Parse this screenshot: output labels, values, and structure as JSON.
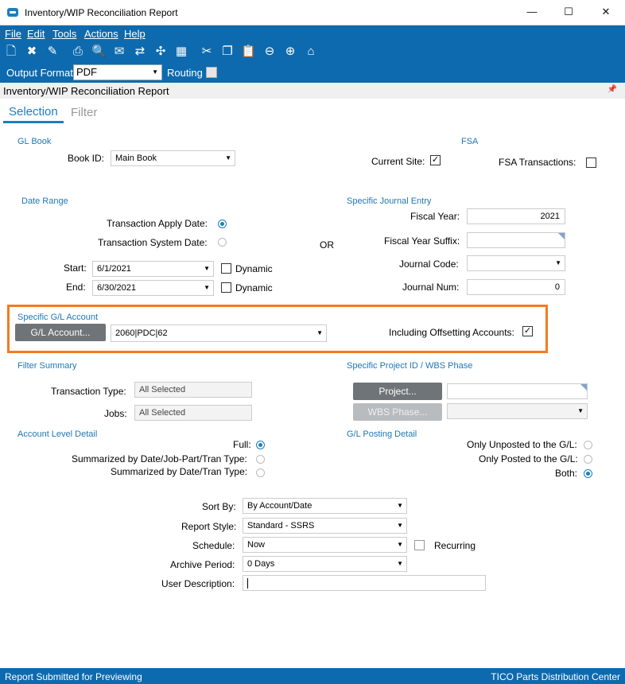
{
  "window": {
    "title": "Inventory/WIP Reconciliation Report",
    "minimize": "—",
    "maximize": "☐",
    "close": "✕"
  },
  "menu": [
    "File",
    "Edit",
    "Tools",
    "Actions",
    "Help"
  ],
  "output": {
    "label": "Output Format:",
    "value": "PDF",
    "routing_label": "Routing",
    "routing_checked": false
  },
  "panel": {
    "title": "Inventory/WIP Reconciliation Report"
  },
  "tabs": {
    "selection": "Selection",
    "filter": "Filter"
  },
  "gl_book": {
    "header": "GL Book",
    "book_id_label": "Book ID:",
    "book_id_value": "Main Book"
  },
  "fsa": {
    "header": "FSA",
    "current_site_label": "Current Site:",
    "current_site_checked": true,
    "fsa_transactions_label": "FSA Transactions:",
    "fsa_transactions_checked": false
  },
  "date_range": {
    "header": "Date Range",
    "apply_label": "Transaction Apply Date:",
    "system_label": "Transaction System Date:",
    "start_label": "Start:",
    "start_value": "6/1/2021",
    "end_label": "End:",
    "end_value": "6/30/2021",
    "dynamic_label": "Dynamic"
  },
  "or_label": "OR",
  "journal": {
    "header": "Specific Journal Entry",
    "fiscal_year_label": "Fiscal Year:",
    "fiscal_year_value": "2021",
    "suffix_label": "Fiscal Year Suffix:",
    "suffix_value": "",
    "code_label": "Journal Code:",
    "code_value": "",
    "num_label": "Journal Num:",
    "num_value": "0"
  },
  "gl_account": {
    "header": "Specific G/L Account",
    "button": "G/L Account...",
    "value": "2060|PDC|62",
    "offsetting_label": "Including Offsetting Accounts:",
    "offsetting_checked": true
  },
  "filter_summary": {
    "header": "Filter Summary",
    "tran_type_label": "Transaction Type:",
    "tran_type_value": "All Selected",
    "jobs_label": "Jobs:",
    "jobs_value": "All Selected"
  },
  "project": {
    "header": "Specific Project ID / WBS Phase",
    "project_button": "Project...",
    "wbs_button": "WBS Phase..."
  },
  "account_level": {
    "header": "Account Level Detail",
    "full": "Full:",
    "summ_job": "Summarized by Date/Job-Part/Tran Type:",
    "summ_tran": "Summarized by Date/Tran Type:"
  },
  "posting": {
    "header": "G/L Posting Detail",
    "unposted": "Only Unposted to the G/L:",
    "posted": "Only Posted to the G/L:",
    "both": "Both:"
  },
  "report": {
    "sort_label": "Sort By:",
    "sort_value": "By Account/Date",
    "style_label": "Report Style:",
    "style_value": "Standard - SSRS",
    "schedule_label": "Schedule:",
    "schedule_value": "Now",
    "recurring_label": "Recurring",
    "archive_label": "Archive Period:",
    "archive_value": "0 Days",
    "user_desc_label": "User Description:",
    "user_desc_value": ""
  },
  "status": {
    "left": "Report Submitted for Previewing",
    "right": "TICO Parts Distribution Center"
  },
  "colors": {
    "chrome_blue": "#0e6aae",
    "accent": "#1a7fc0",
    "highlight": "#f47b20"
  }
}
